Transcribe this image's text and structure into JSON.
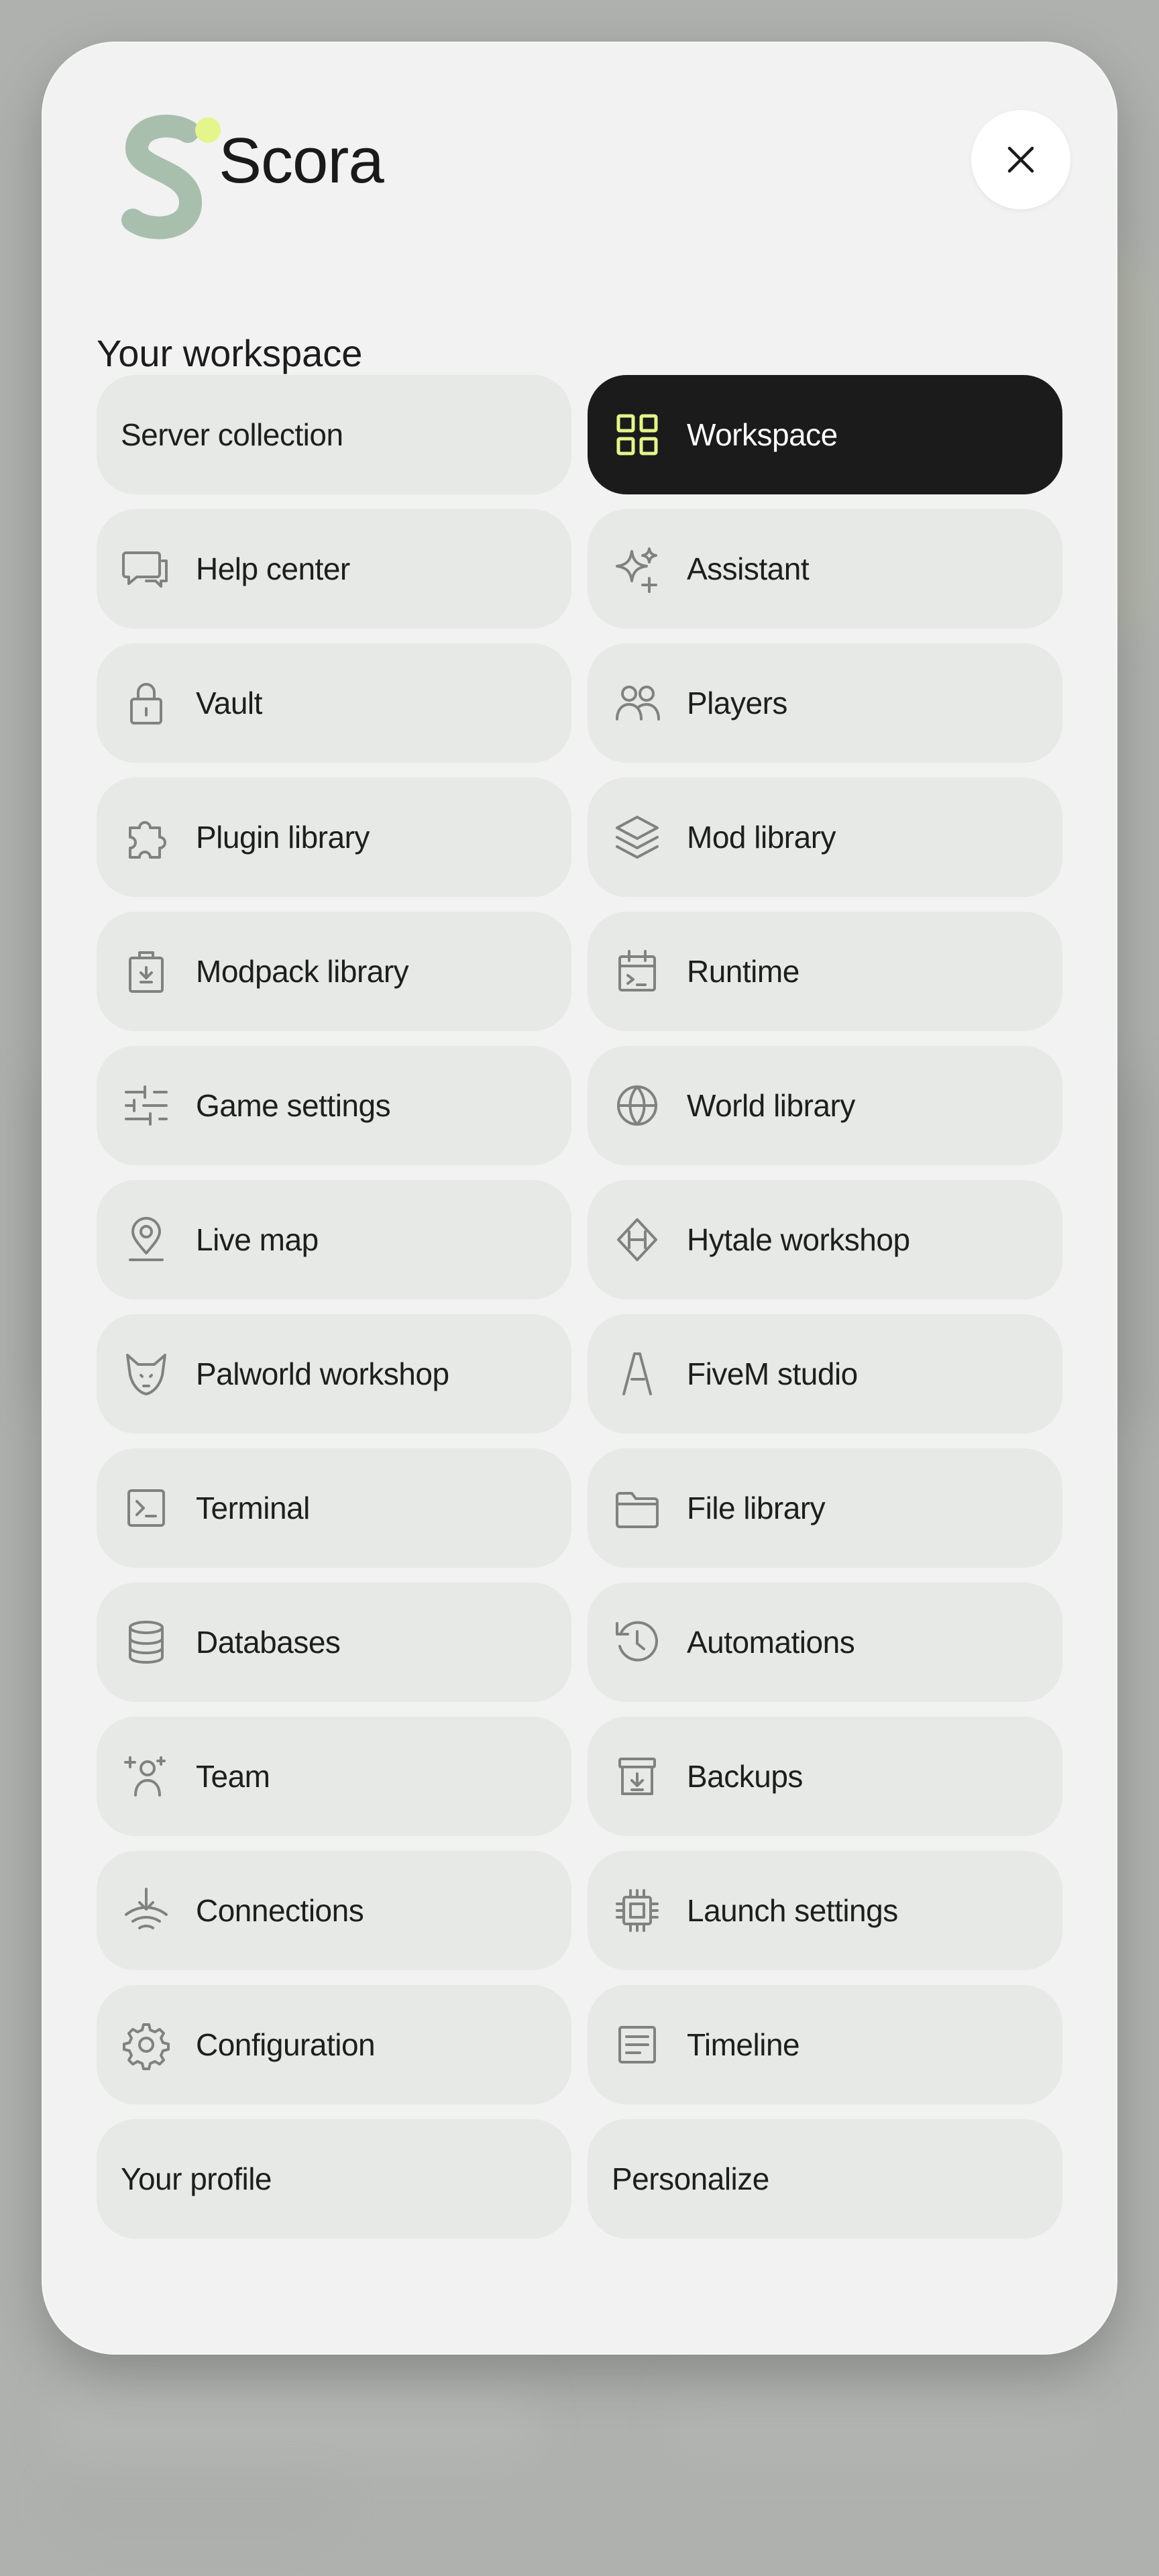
{
  "app": {
    "name": "Scora",
    "accent": "#e4f58b",
    "dark_tile": "#1b1b1c"
  },
  "section_title": "Your workspace",
  "close_icon": "close-icon",
  "tiles": [
    {
      "label": "Server collection",
      "icon": null,
      "active": false
    },
    {
      "label": "Workspace",
      "icon": "grid-icon",
      "active": true
    },
    {
      "label": "Help center",
      "icon": "chat-icon",
      "active": false
    },
    {
      "label": "Assistant",
      "icon": "sparkles-icon",
      "active": false
    },
    {
      "label": "Vault",
      "icon": "lock-icon",
      "active": false
    },
    {
      "label": "Players",
      "icon": "users-icon",
      "active": false
    },
    {
      "label": "Plugin library",
      "icon": "puzzle-icon",
      "active": false
    },
    {
      "label": "Mod library",
      "icon": "layers-icon",
      "active": false
    },
    {
      "label": "Modpack library",
      "icon": "package-icon",
      "active": false
    },
    {
      "label": "Runtime",
      "icon": "calendar-terminal-icon",
      "active": false
    },
    {
      "label": "Game settings",
      "icon": "sliders-icon",
      "active": false
    },
    {
      "label": "World library",
      "icon": "globe-icon",
      "active": false
    },
    {
      "label": "Live map",
      "icon": "map-pin-icon",
      "active": false
    },
    {
      "label": "Hytale workshop",
      "icon": "diamond-icon",
      "active": false
    },
    {
      "label": "Palworld workshop",
      "icon": "fox-icon",
      "active": false
    },
    {
      "label": "FiveM studio",
      "icon": "fivem-icon",
      "active": false
    },
    {
      "label": "Terminal",
      "icon": "terminal-icon",
      "active": false
    },
    {
      "label": "File library",
      "icon": "folder-icon",
      "active": false
    },
    {
      "label": "Databases",
      "icon": "database-icon",
      "active": false
    },
    {
      "label": "Automations",
      "icon": "history-icon",
      "active": false
    },
    {
      "label": "Team",
      "icon": "user-plus-icon",
      "active": false
    },
    {
      "label": "Backups",
      "icon": "archive-icon",
      "active": false
    },
    {
      "label": "Connections",
      "icon": "wifi-download-icon",
      "active": false
    },
    {
      "label": "Launch settings",
      "icon": "cpu-icon",
      "active": false
    },
    {
      "label": "Configuration",
      "icon": "gear-icon",
      "active": false
    },
    {
      "label": "Timeline",
      "icon": "document-lines-icon",
      "active": false
    },
    {
      "label": "Your profile",
      "icon": null,
      "active": false
    },
    {
      "label": "Personalize",
      "icon": null,
      "active": false
    }
  ]
}
